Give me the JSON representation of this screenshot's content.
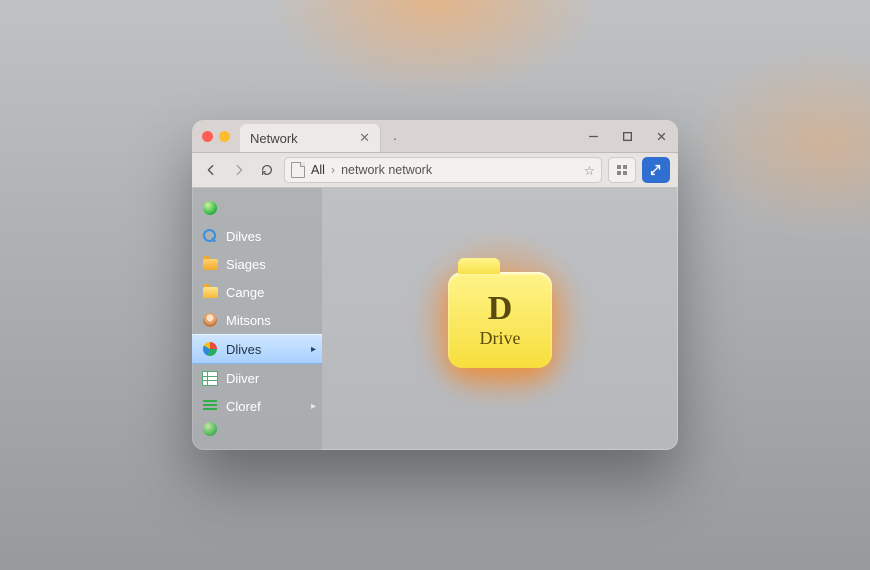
{
  "tab": {
    "title": "Network"
  },
  "toolbar": {
    "breadcrumb_root": "All",
    "breadcrumb_path": "network network"
  },
  "sidebar": {
    "items": [
      {
        "label": "",
        "icon": "globe-icon",
        "active": false,
        "expandable": false
      },
      {
        "label": "Dilves",
        "icon": "search-icon",
        "active": false,
        "expandable": false
      },
      {
        "label": "Siages",
        "icon": "folder-icon",
        "active": false,
        "expandable": false
      },
      {
        "label": "Cange",
        "icon": "folder-icon",
        "active": false,
        "expandable": false
      },
      {
        "label": "Mitsons",
        "icon": "person-icon",
        "active": false,
        "expandable": false
      },
      {
        "label": "Dlives",
        "icon": "pie-icon",
        "active": true,
        "expandable": true
      },
      {
        "label": "Diiver",
        "icon": "table-icon",
        "active": false,
        "expandable": false
      },
      {
        "label": "Cloref",
        "icon": "bars-icon",
        "active": false,
        "expandable": true
      }
    ]
  },
  "content": {
    "drive_letter": "D",
    "drive_label": "Drive"
  }
}
